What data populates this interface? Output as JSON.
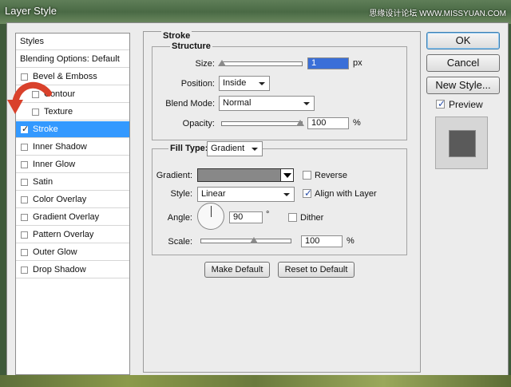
{
  "window": {
    "title": "Layer Style",
    "watermark": "思缘设计论坛 WWW.MISSYUAN.COM"
  },
  "left": {
    "styles_header": "Styles",
    "blending_header": "Blending Options: Default",
    "items": [
      {
        "label": "Bevel & Emboss",
        "checked": false,
        "indent": false
      },
      {
        "label": "Contour",
        "checked": false,
        "indent": true
      },
      {
        "label": "Texture",
        "checked": false,
        "indent": true
      },
      {
        "label": "Stroke",
        "checked": true,
        "indent": false,
        "selected": true
      },
      {
        "label": "Inner Shadow",
        "checked": false,
        "indent": false
      },
      {
        "label": "Inner Glow",
        "checked": false,
        "indent": false
      },
      {
        "label": "Satin",
        "checked": false,
        "indent": false
      },
      {
        "label": "Color Overlay",
        "checked": false,
        "indent": false
      },
      {
        "label": "Gradient Overlay",
        "checked": false,
        "indent": false
      },
      {
        "label": "Pattern Overlay",
        "checked": false,
        "indent": false
      },
      {
        "label": "Outer Glow",
        "checked": false,
        "indent": false
      },
      {
        "label": "Drop Shadow",
        "checked": false,
        "indent": false
      }
    ]
  },
  "stroke": {
    "section_title": "Stroke",
    "structure_title": "Structure",
    "size_label": "Size:",
    "size_value": "1",
    "size_unit": "px",
    "position_label": "Position:",
    "position_value": "Inside",
    "blend_label": "Blend Mode:",
    "blend_value": "Normal",
    "opacity_label": "Opacity:",
    "opacity_value": "100",
    "opacity_unit": "%",
    "filltype_label": "Fill Type:",
    "filltype_value": "Gradient",
    "gradient_label": "Gradient:",
    "reverse_label": "Reverse",
    "reverse_checked": false,
    "style_label": "Style:",
    "style_value": "Linear",
    "align_label": "Align with Layer",
    "align_checked": true,
    "angle_label": "Angle:",
    "angle_value": "90",
    "angle_unit": "°",
    "dither_label": "Dither",
    "dither_checked": false,
    "scale_label": "Scale:",
    "scale_value": "100",
    "scale_unit": "%",
    "make_default": "Make Default",
    "reset_default": "Reset to Default"
  },
  "buttons": {
    "ok": "OK",
    "cancel": "Cancel",
    "new_style": "New Style...",
    "preview_label": "Preview",
    "preview_checked": true
  },
  "colors": {
    "selection": "#3399ff",
    "arrow": "#d9412b",
    "swatch": "#5a5a5a"
  }
}
